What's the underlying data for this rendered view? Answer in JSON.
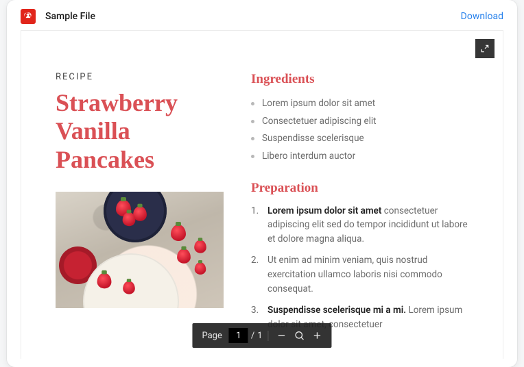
{
  "header": {
    "file_title": "Sample File",
    "download_label": "Download"
  },
  "document": {
    "eyebrow": "RECIPE",
    "title": "Strawberry Vanilla Pancakes",
    "ingredients_heading": "Ingredients",
    "ingredients": [
      "Lorem ipsum dolor sit amet",
      "Consectetuer adipiscing elit",
      "Suspendisse scelerisque",
      "Libero interdum auctor"
    ],
    "preparation_heading": "Preparation",
    "preparation": [
      {
        "lead": "Lorem ipsum dolor sit amet",
        "rest": " consectetuer adipiscing elit sed do tempor incididunt ut labore et dolore magna aliqua."
      },
      {
        "lead": "",
        "rest": "Ut enim ad minim veniam, quis nostrud exercitation ullamco laboris nisi commodo consequat."
      },
      {
        "lead": "Suspendisse scelerisque mi a mi.",
        "rest": " Lorem ipsum dolor sit amet, consectetuer"
      }
    ]
  },
  "toolbar": {
    "page_label": "Page",
    "current_page": "1",
    "separator": "/",
    "total_pages": "1"
  }
}
